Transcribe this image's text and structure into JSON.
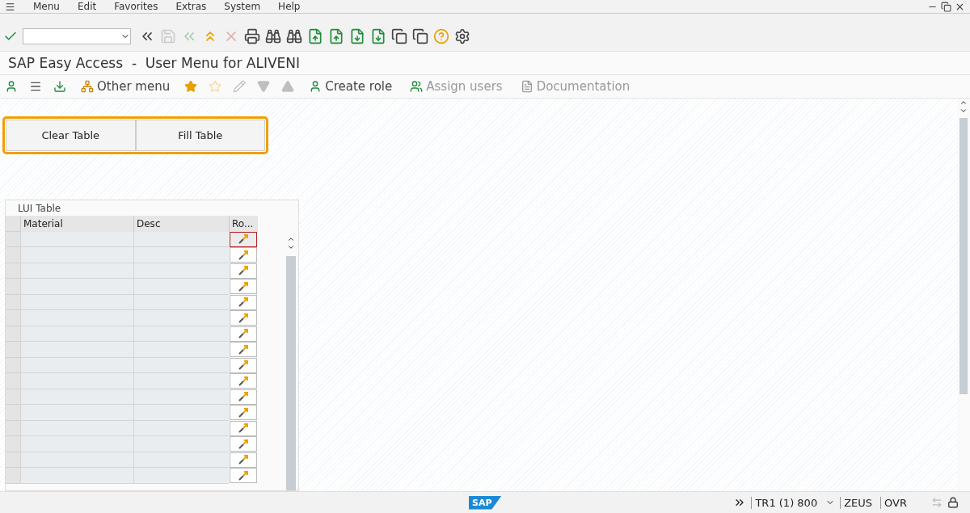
{
  "menu_bar": {
    "items": [
      "Menu",
      "Edit",
      "Favorites",
      "Extras",
      "System",
      "Help"
    ]
  },
  "toolbar": {
    "buttons": [
      {
        "kind": "enter",
        "disabled": false
      },
      {
        "kind": "command",
        "disabled": false
      },
      {
        "kind": "collapse",
        "disabled": false
      },
      {
        "kind": "save",
        "disabled": true
      },
      {
        "kind": "back",
        "disabled": true
      },
      {
        "kind": "exit",
        "disabled": false
      },
      {
        "kind": "cancel",
        "disabled": true
      },
      {
        "kind": "print",
        "disabled": false
      },
      {
        "kind": "find",
        "disabled": false
      },
      {
        "kind": "findnext",
        "disabled": false
      },
      {
        "kind": "first",
        "disabled": false
      },
      {
        "kind": "prev",
        "disabled": false
      },
      {
        "kind": "next",
        "disabled": false
      },
      {
        "kind": "last",
        "disabled": false
      },
      {
        "kind": "newsession",
        "disabled": false
      },
      {
        "kind": "shortcut",
        "disabled": false
      },
      {
        "kind": "help",
        "disabled": false
      },
      {
        "kind": "settings",
        "disabled": false
      }
    ]
  },
  "title": "SAP Easy Access  -  User Menu for ALIVENI",
  "app_toolbar": [
    {
      "kind": "usermenu",
      "disabled": false
    },
    {
      "kind": "sapmenu",
      "disabled": false
    },
    {
      "kind": "download",
      "disabled": false
    },
    {
      "kind": "othermenu",
      "label": "Other menu",
      "disabled": false
    },
    {
      "kind": "addfav",
      "disabled": false
    },
    {
      "kind": "delfav",
      "disabled": true
    },
    {
      "kind": "edit",
      "disabled": true
    },
    {
      "kind": "down",
      "disabled": true
    },
    {
      "kind": "up",
      "disabled": true
    },
    {
      "kind": "createrole",
      "label": "Create role",
      "disabled": false
    },
    {
      "kind": "assign",
      "label": "Assign users",
      "disabled": true
    },
    {
      "kind": "doc",
      "label": "Documentation",
      "disabled": true
    }
  ],
  "buttons": [
    "Clear Table",
    "Fill Table"
  ],
  "table": {
    "title": "LUI Table",
    "columns": [
      "Material",
      "Desc",
      "Ro..."
    ],
    "rows": [
      {
        "focused": true
      },
      {
        "focused": false
      },
      {
        "focused": false
      },
      {
        "focused": false
      },
      {
        "focused": false
      },
      {
        "focused": false
      },
      {
        "focused": false
      },
      {
        "focused": false
      },
      {
        "focused": false
      },
      {
        "focused": false
      },
      {
        "focused": false
      },
      {
        "focused": false
      },
      {
        "focused": false
      },
      {
        "focused": false
      },
      {
        "focused": false
      },
      {
        "focused": false
      }
    ]
  },
  "status_bar": {
    "logo": "SAP",
    "system": "TR1 (1) 800",
    "server": "ZEUS",
    "mode": "OVR"
  }
}
